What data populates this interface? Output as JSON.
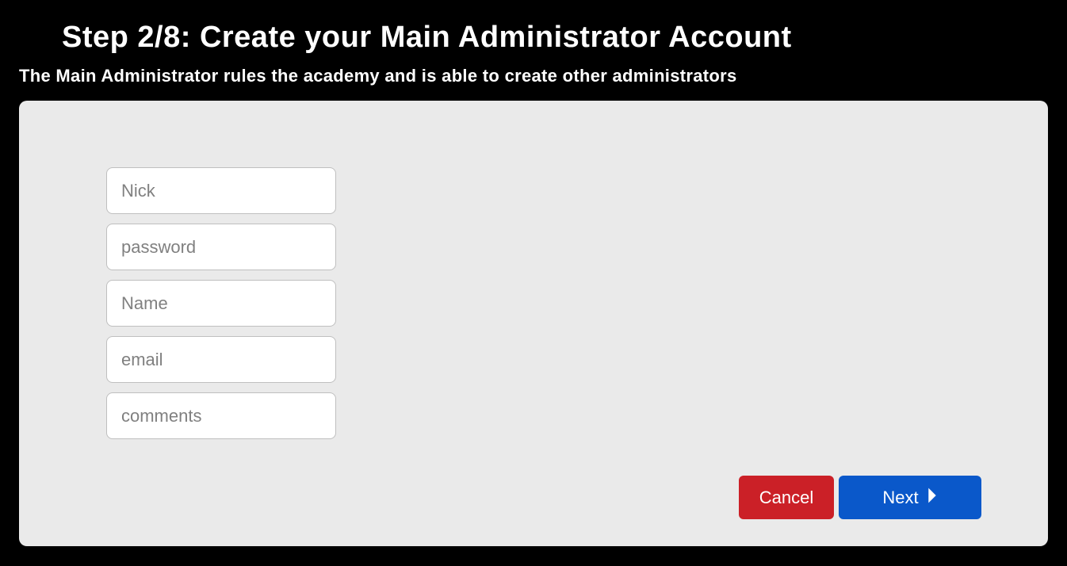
{
  "header": {
    "title": "Step 2/8: Create your Main Administrator Account",
    "subtitle": "The Main Administrator rules the academy and is able to create other administrators"
  },
  "form": {
    "nick": {
      "placeholder": "Nick",
      "value": ""
    },
    "password": {
      "placeholder": "password",
      "value": ""
    },
    "name": {
      "placeholder": "Name",
      "value": ""
    },
    "email": {
      "placeholder": "email",
      "value": ""
    },
    "comments": {
      "placeholder": "comments",
      "value": ""
    }
  },
  "buttons": {
    "cancel": "Cancel",
    "next": "Next"
  }
}
